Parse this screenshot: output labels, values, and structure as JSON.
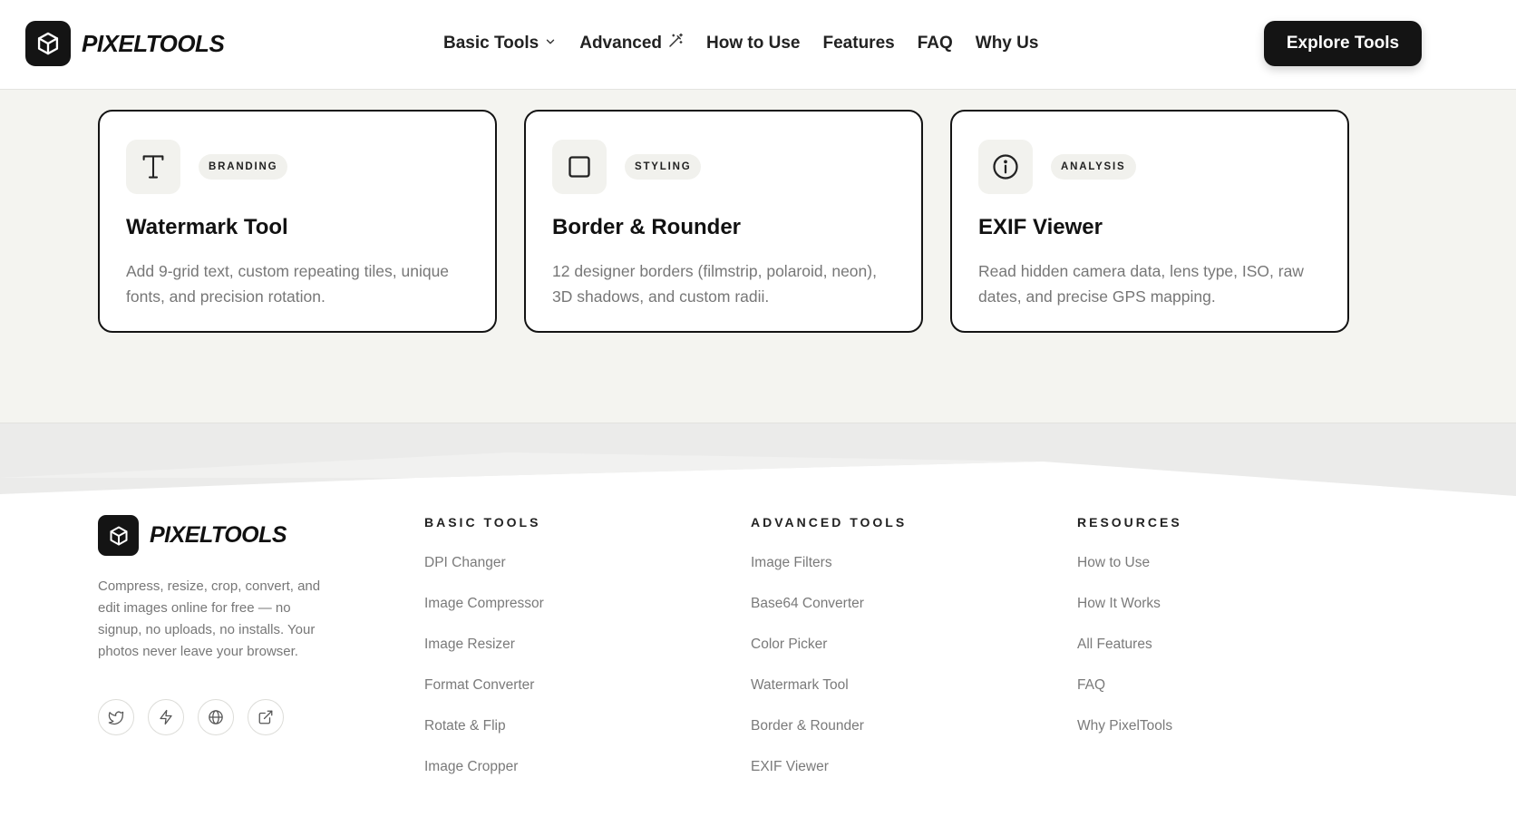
{
  "brand": {
    "name": "PIXELTOOLS",
    "logo_icon": "cube-icon"
  },
  "nav": {
    "items": [
      {
        "label": "Basic Tools",
        "icon": "chevron-down-icon"
      },
      {
        "label": "Advanced",
        "icon": "magic-wand-icon"
      },
      {
        "label": "How to Use"
      },
      {
        "label": "Features"
      },
      {
        "label": "FAQ"
      },
      {
        "label": "Why Us"
      }
    ],
    "cta_label": "Explore Tools"
  },
  "cards": [
    {
      "icon": "text-t-icon",
      "badge": "BRANDING",
      "title": "Watermark Tool",
      "description": "Add 9-grid text, custom repeating tiles, unique fonts, and precision rotation."
    },
    {
      "icon": "square-icon",
      "badge": "STYLING",
      "title": "Border & Rounder",
      "description": "12 designer borders (filmstrip, polaroid, neon), 3D shadows, and custom radii."
    },
    {
      "icon": "info-icon",
      "badge": "ANALYSIS",
      "title": "EXIF Viewer",
      "description": "Read hidden camera data, lens type, ISO, raw dates, and precise GPS mapping."
    }
  ],
  "footer": {
    "tagline": "Compress, resize, crop, convert, and edit images online for free — no signup, no uploads, no installs. Your photos never leave your browser.",
    "socials": [
      "twitter-icon",
      "lightning-icon",
      "globe-icon",
      "external-link-icon"
    ],
    "columns": [
      {
        "heading": "BASIC TOOLS",
        "links": [
          "DPI Changer",
          "Image Compressor",
          "Image Resizer",
          "Format Converter",
          "Rotate & Flip",
          "Image Cropper"
        ]
      },
      {
        "heading": "ADVANCED TOOLS",
        "links": [
          "Image Filters",
          "Base64 Converter",
          "Color Picker",
          "Watermark Tool",
          "Border & Rounder",
          "EXIF Viewer"
        ]
      },
      {
        "heading": "RESOURCES",
        "links": [
          "How to Use",
          "How It Works",
          "All Features",
          "FAQ",
          "Why PixelTools"
        ]
      }
    ]
  },
  "colors": {
    "accent": "#141414",
    "section_bg": "#f4f4f0",
    "muted_text": "#777777"
  }
}
